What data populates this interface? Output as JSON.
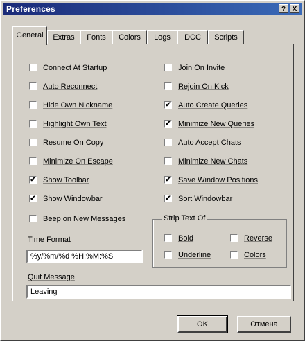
{
  "window": {
    "title": "Preferences",
    "help_glyph": "?",
    "close_glyph": "X"
  },
  "tabs": [
    {
      "label": "General",
      "active": true
    },
    {
      "label": "Extras",
      "active": false
    },
    {
      "label": "Fonts",
      "active": false
    },
    {
      "label": "Colors",
      "active": false
    },
    {
      "label": "Logs",
      "active": false
    },
    {
      "label": "DCC",
      "active": false
    },
    {
      "label": "Scripts",
      "active": false
    }
  ],
  "options_left": [
    {
      "label": "Connect At Startup",
      "checked": false
    },
    {
      "label": "Auto Reconnect",
      "checked": false
    },
    {
      "label": "Hide Own Nickname",
      "checked": false
    },
    {
      "label": "Highlight Own Text",
      "checked": false
    },
    {
      "label": "Resume On Copy",
      "checked": false
    },
    {
      "label": "Minimize On Escape",
      "checked": false
    },
    {
      "label": "Show Toolbar",
      "checked": true
    },
    {
      "label": "Show Windowbar",
      "checked": true
    },
    {
      "label": "Beep on New Messages",
      "checked": false
    }
  ],
  "options_right": [
    {
      "label": "Join On Invite",
      "checked": false
    },
    {
      "label": "Rejoin On Kick",
      "checked": false
    },
    {
      "label": "Auto Create Queries",
      "checked": true
    },
    {
      "label": "Minimize New Queries",
      "checked": true
    },
    {
      "label": "Auto Accept Chats",
      "checked": false
    },
    {
      "label": "Minimize New Chats",
      "checked": false
    },
    {
      "label": "Save Window Positions",
      "checked": true
    },
    {
      "label": "Sort Windowbar",
      "checked": true
    }
  ],
  "strip_text": {
    "legend": "Strip Text Of",
    "options": [
      {
        "label": "Bold",
        "checked": false
      },
      {
        "label": "Reverse",
        "checked": false
      },
      {
        "label": "Underline",
        "checked": false
      },
      {
        "label": "Colors",
        "checked": false
      }
    ]
  },
  "time_format": {
    "label": "Time Format",
    "value": "%y/%m/%d %H:%M:%S"
  },
  "quit_message": {
    "label": "Quit Message",
    "value": "Leaving"
  },
  "buttons": {
    "ok": "OK",
    "cancel": "Отмена"
  },
  "check_glyph": "✔"
}
